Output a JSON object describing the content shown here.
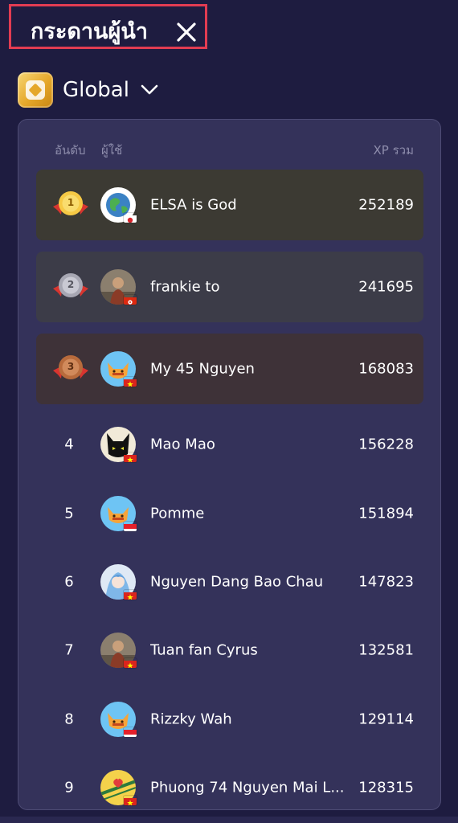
{
  "header": {
    "title": "กระดานผู้นำ",
    "close_icon": "close-icon",
    "highlight_color": "#e23c52"
  },
  "scope": {
    "icon": "leaderboard-badge-icon",
    "label": "Global",
    "dropdown_icon": "chevron-down-icon"
  },
  "table": {
    "columns": {
      "rank": "อันดับ",
      "user": "ผู้ใช้",
      "xp": "XP รวม"
    },
    "rows": [
      {
        "rank": "1",
        "name": "ELSA is God",
        "xp": "252189",
        "medal": "gold",
        "avatar": "globe-avatar",
        "flag": "japan"
      },
      {
        "rank": "2",
        "name": "frankie to",
        "xp": "241695",
        "medal": "silver",
        "avatar": "photo-avatar",
        "flag": "hong-kong"
      },
      {
        "rank": "3",
        "name": "My 45 Nguyen",
        "xp": "168083",
        "medal": "bronze",
        "avatar": "fox-avatar",
        "flag": "vietnam"
      },
      {
        "rank": "4",
        "name": "Mao Mao",
        "xp": "156228",
        "medal": "",
        "avatar": "black-cat-avatar",
        "flag": "vietnam"
      },
      {
        "rank": "5",
        "name": "Pomme",
        "xp": "151894",
        "medal": "",
        "avatar": "fox-avatar",
        "flag": "indonesia"
      },
      {
        "rank": "6",
        "name": "Nguyen Dang Bao Chau",
        "xp": "147823",
        "medal": "",
        "avatar": "anime-avatar",
        "flag": "vietnam"
      },
      {
        "rank": "7",
        "name": "Tuan fan Cyrus",
        "xp": "132581",
        "medal": "",
        "avatar": "photo-avatar",
        "flag": "vietnam"
      },
      {
        "rank": "8",
        "name": "Rizzky Wah",
        "xp": "129114",
        "medal": "",
        "avatar": "fox-avatar",
        "flag": "indonesia"
      },
      {
        "rank": "9",
        "name": "Phuong 74 Nguyen Mai L...",
        "xp": "128315",
        "medal": "",
        "avatar": "yellow-pattern-avatar",
        "flag": "vietnam"
      }
    ]
  },
  "colors": {
    "background": "#1e1c40",
    "panel": "#34325a",
    "gold_row": "#3c3a33",
    "silver_row": "#3c3c48",
    "bronze_row": "#3e3238",
    "muted_text": "#8d8cab"
  }
}
